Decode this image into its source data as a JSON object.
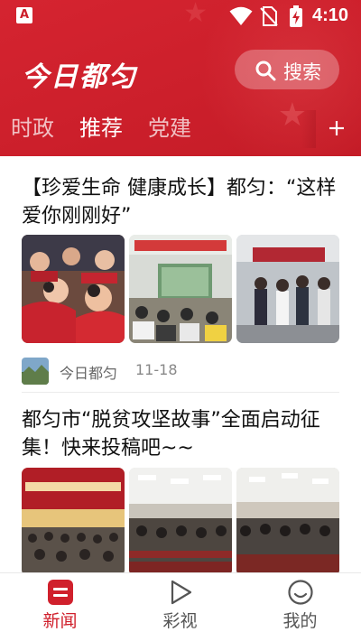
{
  "status_bar": {
    "app_badge": "A",
    "time": "4:10"
  },
  "header": {
    "logo_text": "今日都匀",
    "search_label": "搜索",
    "tabs": [
      {
        "label": "时政",
        "active": false
      },
      {
        "label": "推荐",
        "active": true
      },
      {
        "label": "党建",
        "active": false
      }
    ],
    "add_channel_icon": "plus-icon"
  },
  "feed": {
    "articles": [
      {
        "title": "【珍爱生命 健康成长】都匀：“这样爱你刚刚好”",
        "image_count": 3,
        "source": "今日都匀",
        "date": "11-18"
      },
      {
        "title": "都匀市“脱贫攻坚故事”全面启动征集！快来投稿吧~~",
        "image_count": 3
      }
    ]
  },
  "bottom_nav": {
    "items": [
      {
        "label": "新闻",
        "icon": "news-icon",
        "active": true
      },
      {
        "label": "彩视",
        "icon": "play-icon",
        "active": false
      },
      {
        "label": "我的",
        "icon": "smiley-icon",
        "active": false
      }
    ]
  },
  "colors": {
    "brand_red": "#cc1f2b",
    "active_nav": "#d0202c",
    "background": "#ffffff"
  }
}
